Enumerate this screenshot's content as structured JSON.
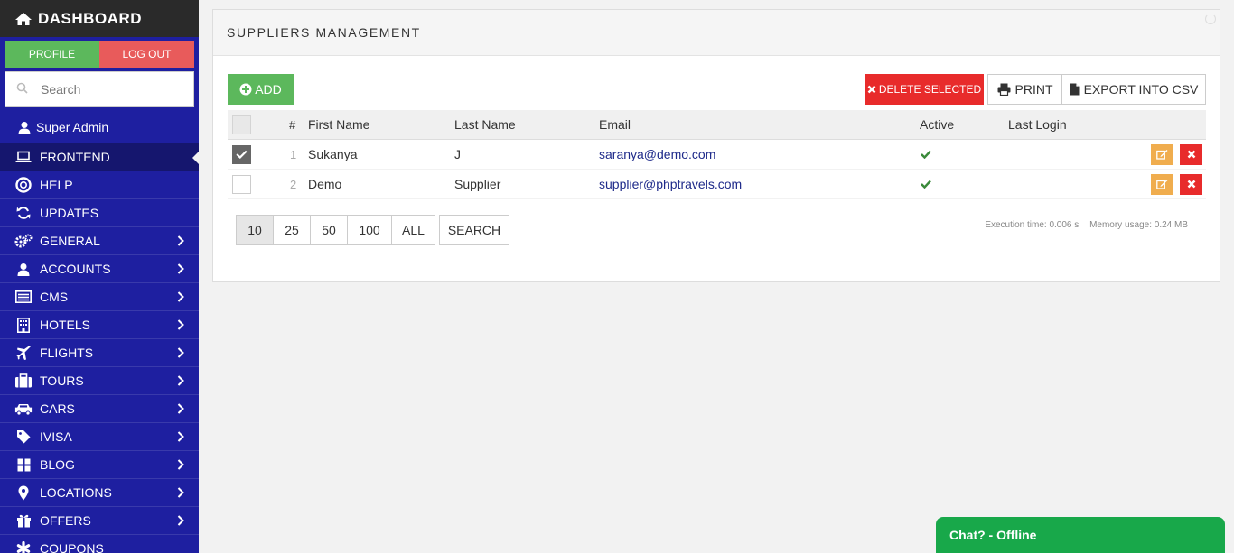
{
  "brand": {
    "title": "DASHBOARD",
    "icon": "home-icon"
  },
  "profile_row": {
    "profile": "PROFILE",
    "logout": "LOG OUT"
  },
  "search": {
    "placeholder": "Search",
    "icon": "search-icon"
  },
  "user": {
    "name": "Super Admin",
    "icon": "user-icon"
  },
  "nav": [
    {
      "label": "FRONTEND",
      "icon": "laptop-icon",
      "active": true,
      "chevron": false
    },
    {
      "label": "HELP",
      "icon": "lifebuoy-icon",
      "chevron": false
    },
    {
      "label": "UPDATES",
      "icon": "refresh-icon",
      "chevron": false
    },
    {
      "label": "GENERAL",
      "icon": "cogs-icon",
      "chevron": true
    },
    {
      "label": "ACCOUNTS",
      "icon": "user-icon",
      "chevron": true
    },
    {
      "label": "CMS",
      "icon": "list-icon",
      "chevron": true
    },
    {
      "label": "HOTELS",
      "icon": "building-icon",
      "chevron": true
    },
    {
      "label": "FLIGHTS",
      "icon": "plane-icon",
      "chevron": true
    },
    {
      "label": "TOURS",
      "icon": "suitcase-icon",
      "chevron": true
    },
    {
      "label": "CARS",
      "icon": "car-icon",
      "chevron": true
    },
    {
      "label": "IVISA",
      "icon": "tag-icon",
      "chevron": true
    },
    {
      "label": "BLOG",
      "icon": "grid-icon",
      "chevron": true
    },
    {
      "label": "LOCATIONS",
      "icon": "map-marker-icon",
      "chevron": true
    },
    {
      "label": "OFFERS",
      "icon": "gift-icon",
      "chevron": true
    },
    {
      "label": "COUPONS",
      "icon": "asterisk-icon",
      "chevron": false
    }
  ],
  "panel": {
    "title": "SUPPLIERS MANAGEMENT",
    "add_label": "ADD",
    "delete_label": "DELETE SELECTED",
    "print_label": "PRINT",
    "csv_label": "EXPORT INTO CSV"
  },
  "table": {
    "headers": {
      "num": "#",
      "first": "First Name",
      "last": "Last Name",
      "email": "Email",
      "active": "Active",
      "last_login": "Last Login"
    },
    "rows": [
      {
        "num": "1",
        "first": "Sukanya",
        "last": "J",
        "email": "saranya@demo.com",
        "active": true,
        "checked": true,
        "last_login": ""
      },
      {
        "num": "2",
        "first": "Demo",
        "last": "Supplier",
        "email": "supplier@phptravels.com",
        "active": true,
        "checked": false,
        "last_login": ""
      }
    ]
  },
  "pagination": {
    "options": [
      "10",
      "25",
      "50",
      "100",
      "ALL"
    ],
    "selected": "10",
    "search_label": "SEARCH"
  },
  "exec": {
    "time": "Execution time: 0.006 s",
    "memory": "Memory usage: 0.24 MB"
  },
  "chat": {
    "label": "Chat? - Offline"
  },
  "colors": {
    "sidebar": "#1e1fa0",
    "add": "#5cb85c",
    "delete": "#e82b2b",
    "edit": "#f0ad4e",
    "chat": "#18a84a",
    "link": "#1e2a8a"
  }
}
